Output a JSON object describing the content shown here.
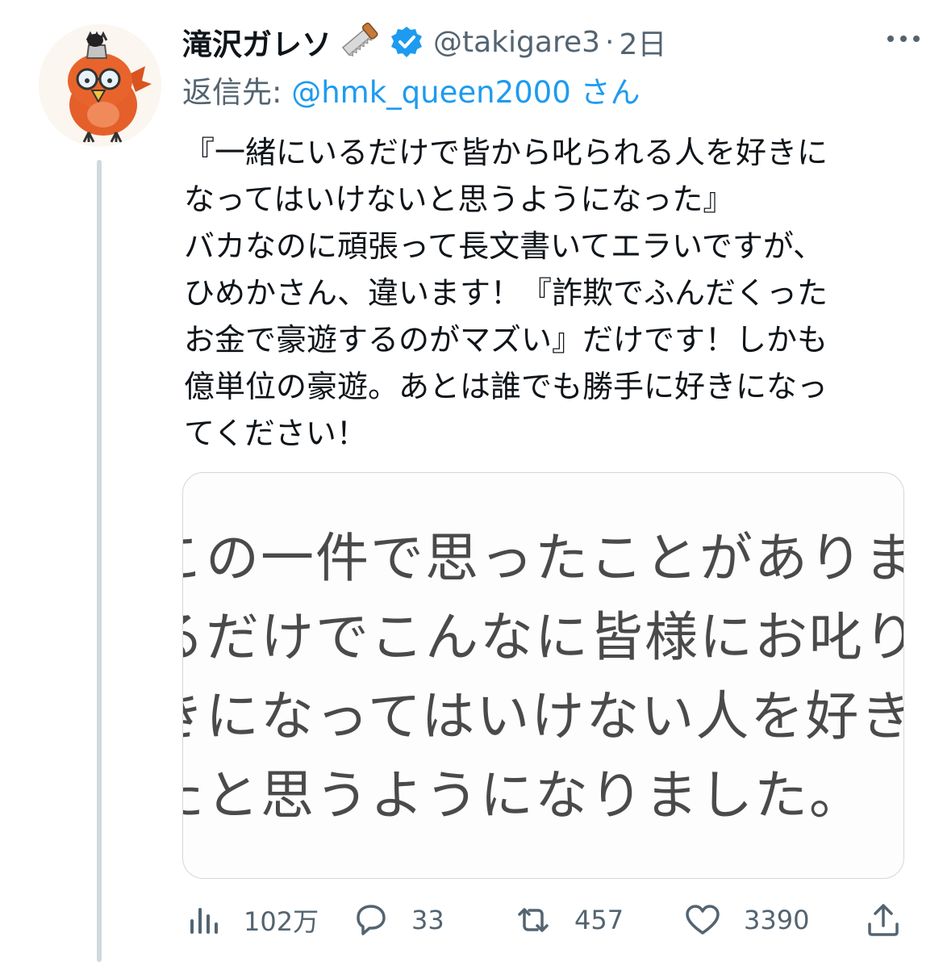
{
  "tweet": {
    "display_name": "滝沢ガレソ",
    "handle": "@takigare3",
    "separator": "·",
    "time": "2日",
    "reply_prefix": "返信先: ",
    "reply_mention": "@hmk_queen2000",
    "reply_suffix": " さん",
    "body_lines": [
      "『一緒にいるだけで皆から叱られる人を好きに",
      "なってはいけないと思うようになった』",
      "バカなのに頑張って長文書いてエラいですが、",
      "ひめかさん、違います！『詐欺でふんだくった",
      "お金で豪遊するのがマズい』だけです！しかも",
      "億単位の豪遊。あとは誰でも勝手に好きになっ",
      "てください！"
    ],
    "media_lines": [
      "この一件で思ったことがあります",
      "るだけでこんなに皆様にお叱りを",
      "きになってはいけない人を好きに",
      "たと思うようになりました。"
    ]
  },
  "actions": {
    "views": "102万",
    "replies": "33",
    "retweets": "457",
    "likes": "3390"
  },
  "icons": {
    "saw": "saw-icon",
    "verified": "verified-badge-icon",
    "more": "more-icon",
    "views": "views-icon",
    "reply": "reply-icon",
    "retweet": "retweet-icon",
    "like": "like-icon",
    "share": "share-icon"
  },
  "colors": {
    "text": "#0f1419",
    "secondary": "#536471",
    "accent": "#1d9bf0",
    "thread_line": "#cfd9de"
  }
}
